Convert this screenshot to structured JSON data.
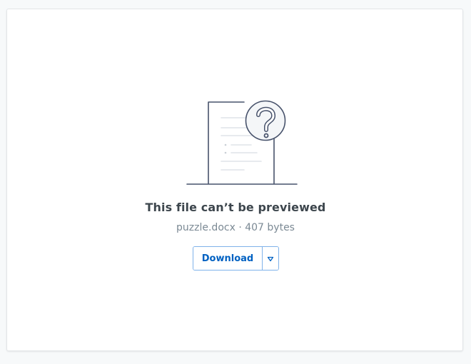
{
  "preview": {
    "title": "This file can’t be previewed",
    "file_name": "puzzle.docx",
    "separator": " · ",
    "file_size": "407 bytes",
    "illustration_icon": "document-question-icon"
  },
  "actions": {
    "download_label": "Download",
    "dropdown_icon": "chevron-down-icon"
  },
  "colors": {
    "accent": "#0061c2",
    "button_border": "#7fb2ea",
    "title_text": "#3d464d",
    "meta_text": "#7b8994",
    "illustration_stroke": "#47526b"
  }
}
